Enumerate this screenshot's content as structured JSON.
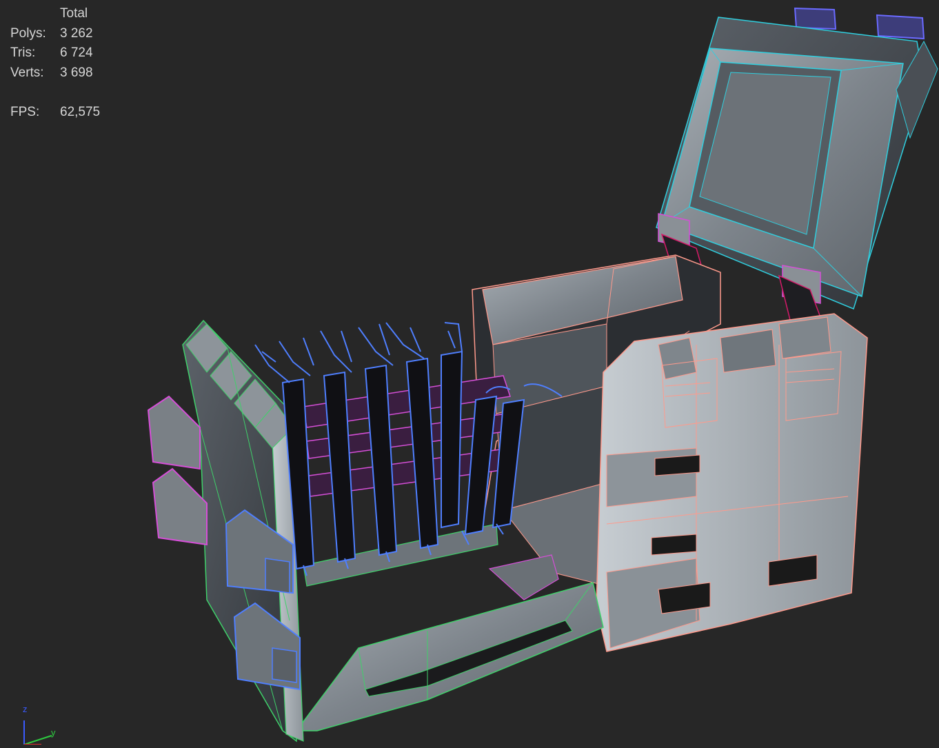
{
  "stats": {
    "header": "Total",
    "rows": [
      {
        "label": "Polys:",
        "value": "3 262"
      },
      {
        "label": "Tris:",
        "value": "6 724"
      },
      {
        "label": "Verts:",
        "value": "3 698"
      }
    ],
    "fps_label": "FPS:",
    "fps_value": "62,575"
  },
  "axis_gizmo": {
    "z_label": "z",
    "y_label": "y"
  },
  "colors": {
    "background": "#272727",
    "wire_cyan": "#2fd0e0",
    "wire_pink": "#ff9a8c",
    "wire_magenta": "#d64fd8",
    "wire_blue": "#4f7fff",
    "wire_green": "#3fd16a",
    "surface": "#8e959c"
  }
}
